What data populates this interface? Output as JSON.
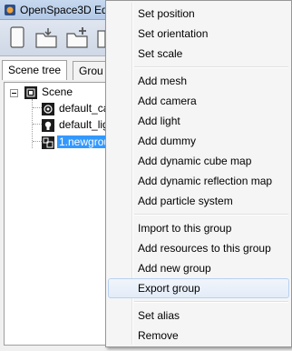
{
  "window": {
    "title": "OpenSpace3D Edi"
  },
  "tabs": [
    {
      "label": "Scene tree",
      "active": true
    },
    {
      "label": "Grou",
      "active": false
    }
  ],
  "tree": {
    "root": {
      "label": "Scene"
    },
    "children": [
      {
        "label": "default_ca",
        "icon": "camera-icon"
      },
      {
        "label": "default_lig",
        "icon": "light-icon"
      },
      {
        "label": "1.newgrou",
        "icon": "group-icon",
        "selected": true
      }
    ]
  },
  "context_menu": {
    "groups": [
      [
        "Set position",
        "Set orientation",
        "Set scale"
      ],
      [
        "Add mesh",
        "Add camera",
        "Add light",
        "Add dummy",
        "Add dynamic cube map",
        "Add dynamic reflection map",
        "Add particle system"
      ],
      [
        "Import to this group",
        "Add resources to this group",
        "Add new group",
        "Export group"
      ],
      [
        "Set alias",
        "Remove"
      ]
    ],
    "hovered": "Export group"
  },
  "colors": {
    "selection": "#3399ff",
    "menu_hover_border": "#b8d1f0"
  }
}
